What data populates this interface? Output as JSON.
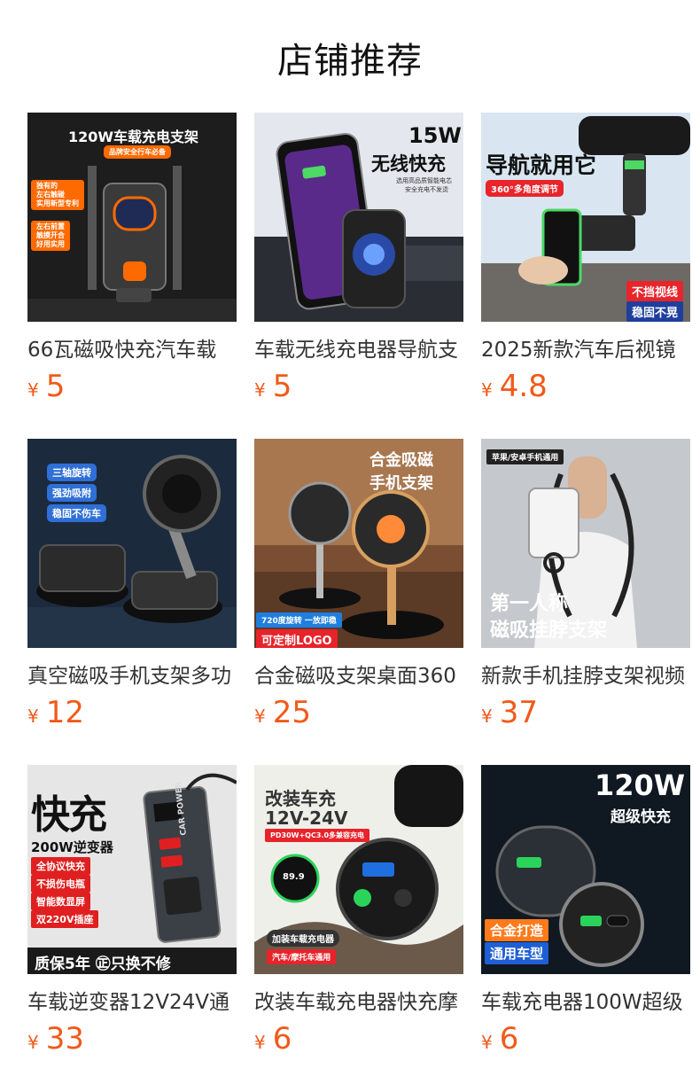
{
  "section_title": "店铺推荐",
  "products": [
    {
      "title": "66瓦磁吸快充汽车载",
      "currency": "¥",
      "price": "5",
      "image": {
        "headline": "120W车载充电支架",
        "tagline": "品牌安全行车必备",
        "badges": [
          "独有的\n左右触碰\n实用新型专利",
          "左右前置\n触摸开合\n好用实用"
        ],
        "colors": {
          "bg": "#1b1b1b",
          "accent": "#ff6a00"
        }
      }
    },
    {
      "title": "车载无线充电器导航支",
      "currency": "¥",
      "price": "5",
      "image": {
        "headline_1": "15W",
        "headline_2": "无线快充",
        "tagline_1": "选用高品质智能电芯",
        "tagline_2": "安全充电不发烫",
        "colors": {
          "bg": "#dfe4ea"
        }
      }
    },
    {
      "title": "2025新款汽车后视镜",
      "currency": "¥",
      "price": "4.8",
      "image": {
        "headline": "导航就用它",
        "tag": "360°多角度调节",
        "badge_1": "不挡视线",
        "badge_2": "稳固不晃",
        "colors": {
          "bg": "#dce8f2",
          "tag": "#e8252b"
        }
      }
    },
    {
      "title": "真空磁吸手机支架多功",
      "currency": "¥",
      "price": "12",
      "image": {
        "labels": [
          "三轴旋转",
          "强劲吸附",
          "稳固不伤车"
        ],
        "colors": {
          "bg": "#1c2a3e",
          "pill": "#2f6fd6"
        }
      }
    },
    {
      "title": "合金磁吸支架桌面360",
      "currency": "¥",
      "price": "25",
      "image": {
        "headline_1": "合金吸磁",
        "headline_2": "手机支架",
        "tag_1": "720度旋转 一放即稳",
        "tag_2": "可定制LOGO",
        "colors": {
          "bg": "#8a5a3a"
        }
      }
    },
    {
      "title": "新款手机挂脖支架视频",
      "currency": "¥",
      "price": "37",
      "image": {
        "tag": "苹果/安卓手机通用",
        "headline_1": "第一人称",
        "headline_2": "磁吸挂脖支架",
        "colors": {
          "bg": "#bfc3c7"
        }
      }
    },
    {
      "title": "车载逆变器12V24V通",
      "currency": "¥",
      "price": "33",
      "image": {
        "headline": "快充",
        "subhead": "200W逆变器",
        "features": [
          "全协议快充",
          "不损伤电瓶",
          "智能数显屏",
          "双220V插座"
        ],
        "device_label": "CAR POWER",
        "footer": "质保5年 ㊣只换不修",
        "colors": {
          "bg": "#e7e7e7",
          "red": "#e02020"
        }
      }
    },
    {
      "title": "改装车载充电器快充摩",
      "currency": "¥",
      "price": "6",
      "image": {
        "headline_1": "改装车充",
        "headline_2": "12V-24V",
        "tag": "PD30W+QC3.0多兼容充电",
        "voltage": "89.9",
        "caption_1": "加装车载充电器",
        "caption_2": "汽车/摩托车通用",
        "colors": {
          "bg": "#f0f0ec",
          "red": "#e8232a"
        }
      }
    },
    {
      "title": "车载充电器100W超级",
      "currency": "¥",
      "price": "6",
      "image": {
        "headline_1": "120W",
        "headline_2": "超级快充",
        "badge_1": "合金打造",
        "badge_2": "通用车型",
        "colors": {
          "bg": "#121a24",
          "orange": "#ff7a1a",
          "blue": "#1f5fd6"
        }
      }
    }
  ]
}
